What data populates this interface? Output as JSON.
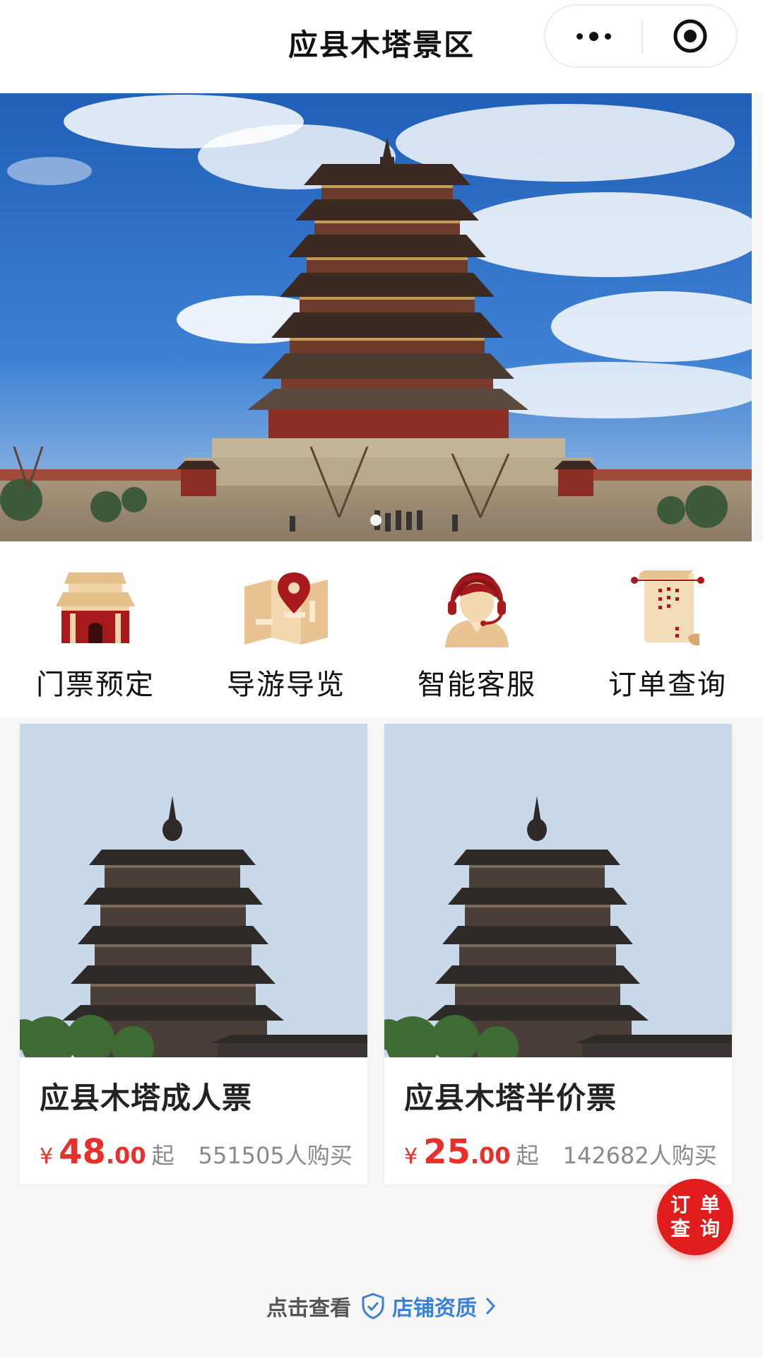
{
  "header": {
    "title": "应县木塔景区",
    "more_icon": "more-dots-icon",
    "close_icon": "target-circle-icon"
  },
  "banner": {
    "image": "wooden-pagoda-photo",
    "slide_count": 1,
    "active_slide": 1
  },
  "quick_nav": [
    {
      "label": "门票预定",
      "icon": "temple-gate-icon"
    },
    {
      "label": "导游导览",
      "icon": "map-pin-icon"
    },
    {
      "label": "智能客服",
      "icon": "customer-service-icon"
    },
    {
      "label": "订单查询",
      "icon": "scroll-icon"
    }
  ],
  "products": [
    {
      "title": "应县木塔成人票",
      "currency": "¥",
      "price_int": "48",
      "price_dec": ".00",
      "price_suffix": "起",
      "buyers": "551505人购买",
      "image": "pagoda-photo"
    },
    {
      "title": "应县木塔半价票",
      "currency": "¥",
      "price_int": "25",
      "price_dec": ".00",
      "price_suffix": "起",
      "buyers": "142682人购买",
      "image": "pagoda-photo"
    }
  ],
  "fab": {
    "line1": "订单",
    "line2": "查询"
  },
  "footer": {
    "prefix": "点击查看",
    "link_text": "店铺资质",
    "shield_icon": "shield-check-icon",
    "arrow_icon": "chevron-right-icon"
  },
  "colors": {
    "accent_red": "#e8302a",
    "fab_red": "#e11c1c",
    "link_blue": "#3b82d6"
  }
}
